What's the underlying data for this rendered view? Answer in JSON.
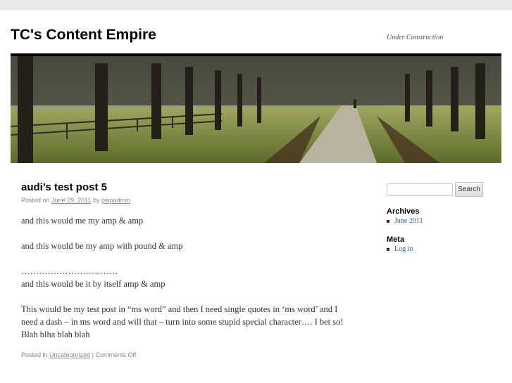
{
  "site": {
    "title": "TC's Content Empire",
    "description": "Under Construction"
  },
  "post": {
    "title": "audi’s test post 5",
    "posted_on_label": "Posted on",
    "date": "June 29, 2011",
    "by_label": "by",
    "author": "pwpadmin",
    "paragraphs": [
      "and this would me my amp & amp",
      "and this would be my amp with pound & amp",
      "……………………………",
      "and this would be it by itself amp & amp",
      "This would be my test post in “ms word” and then I need single quotes in ‘ms word’ and I need a dash – in ms word and will that – turn into some stupid special character…. I bet so! Blah blha blah blah"
    ],
    "posted_in_label": "Posted in",
    "category": "Uncategorized",
    "separator": "|",
    "comments": "Comments Off"
  },
  "sidebar": {
    "search_button": "Search",
    "search_value": "",
    "archives_title": "Archives",
    "archives": [
      "June 2011"
    ],
    "meta_title": "Meta",
    "meta_links": [
      "Log in"
    ]
  },
  "colors": {
    "link": "#2a5c9a",
    "header_border": "#000000"
  }
}
